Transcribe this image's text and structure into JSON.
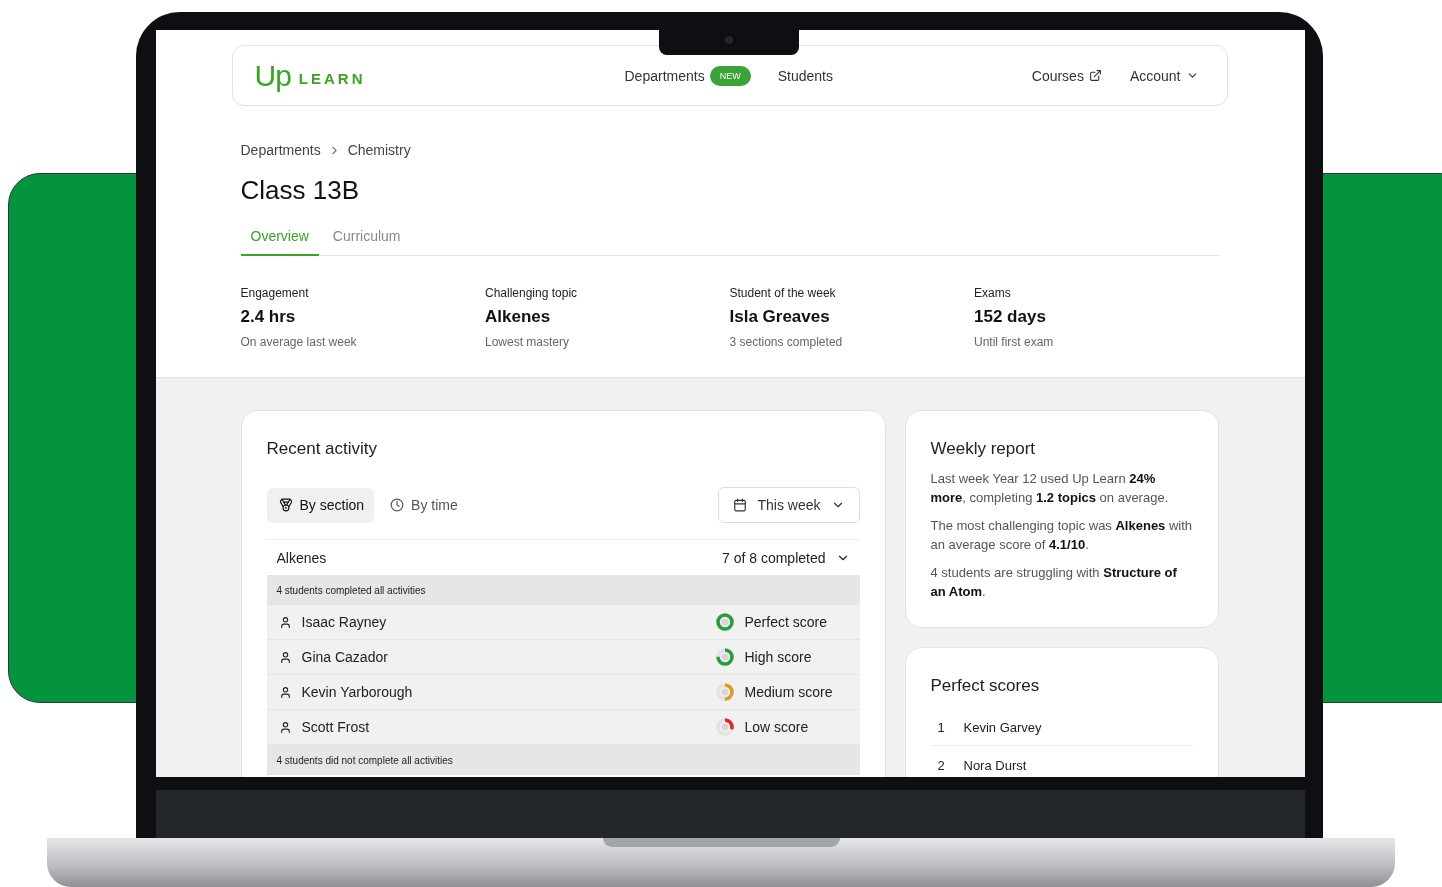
{
  "logo": {
    "mark": "Up",
    "word": "LEARN"
  },
  "nav": {
    "items": [
      {
        "label": "Departments",
        "badge": "NEW",
        "selected": false
      },
      {
        "label": "Students",
        "selected": false
      }
    ],
    "right": [
      {
        "label": "Courses",
        "kind": "external"
      },
      {
        "label": "Account",
        "kind": "menu"
      }
    ]
  },
  "breadcrumb": [
    "Departments",
    "Chemistry"
  ],
  "title": "Class 13B",
  "tabs": [
    {
      "label": "Overview",
      "selected": true
    },
    {
      "label": "Curriculum",
      "selected": false
    }
  ],
  "stats": [
    {
      "label": "Engagement",
      "value": "2.4 hrs",
      "note": "On average last week"
    },
    {
      "label": "Challenging topic",
      "value": "Alkenes",
      "note": "Lowest mastery"
    },
    {
      "label": "Student of the week",
      "value": "Isla Greaves",
      "note": "3 sections completed"
    },
    {
      "label": "Exams",
      "value": "152 days",
      "note": "Until first exam"
    }
  ],
  "recent_activity": {
    "title": "Recent activity",
    "toggles": [
      {
        "label": "By section",
        "kind": "medal",
        "selected": true
      },
      {
        "label": "By time",
        "kind": "clock",
        "selected": false
      }
    ],
    "period": "This week",
    "section": {
      "name": "Alkenes",
      "progress": "7 of 8 completed",
      "expanded": true
    },
    "groups": [
      {
        "heading": "4 students completed all activities",
        "students": [
          {
            "name": "Isaac Rayney",
            "score": "Perfect score",
            "kind": "perfect",
            "color": "#2a9d3a"
          },
          {
            "name": "Gina Cazador",
            "score": "High score",
            "kind": "high",
            "color": "#2a9d3a"
          },
          {
            "name": "Kevin Yarborough",
            "score": "Medium score",
            "kind": "medium",
            "color": "#e09a1f"
          },
          {
            "name": "Scott Frost",
            "score": "Low score",
            "kind": "low",
            "color": "#e0262a"
          }
        ]
      },
      {
        "heading": "4 students did not complete all activities"
      }
    ]
  },
  "weekly_report": {
    "title": "Weekly report",
    "paragraphs": [
      "Last week Year 12 used Up Learn **24% more**, completing **1.2 topics** on average.",
      "The most challenging topic was **Alkenes** with an average score of **4.1/10**.",
      "4 students are struggling with **Structure of an Atom**."
    ]
  },
  "perfect_scores": {
    "title": "Perfect scores",
    "rows": [
      {
        "rank": "1",
        "name": "Kevin Garvey"
      },
      {
        "rank": "2",
        "name": "Nora Durst"
      }
    ]
  }
}
